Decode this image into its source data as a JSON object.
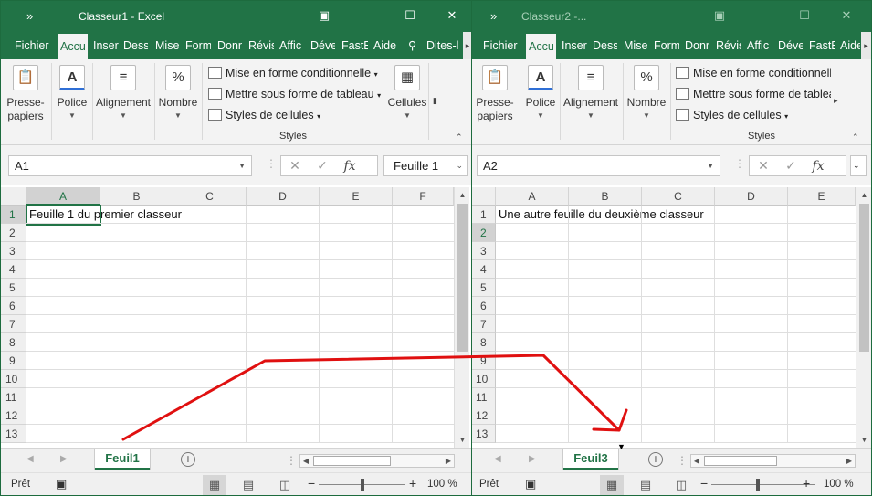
{
  "window1": {
    "title": "Classeur1  -  Excel",
    "tabs": [
      "Fichier",
      "Accu",
      "Inser",
      "Dess",
      "Mise",
      "Form",
      "Donr",
      "Révis",
      "Affic",
      "Déve",
      "FastE",
      "Aide"
    ],
    "tell_me": "Dites-l",
    "ribbon": {
      "paste": "Presse-\npapiers",
      "font": "Police",
      "alignment": "Alignement",
      "number": "Nombre",
      "cond_format": "Mise en forme conditionnelle",
      "table_format": "Mettre sous forme de tableau",
      "cell_styles": "Styles de cellules",
      "styles_group": "Styles",
      "cells": "Cellules"
    },
    "name_box": "A1",
    "formula": "Feuille 1",
    "columns": [
      "A",
      "B",
      "C",
      "D",
      "E",
      "F"
    ],
    "rows": [
      "1",
      "2",
      "3",
      "4",
      "5",
      "6",
      "7",
      "8",
      "9",
      "10",
      "11",
      "12",
      "13"
    ],
    "cell_a1": "Feuille 1 du premier classeur",
    "sheet_tab": "Feuil1",
    "status": "Prêt",
    "zoom": "100 %"
  },
  "window2": {
    "title": "Classeur2  -...",
    "tabs": [
      "Fichier",
      "Accu",
      "Inser",
      "Dess",
      "Mise",
      "Form",
      "Donr",
      "Révis",
      "Affic",
      "Déve",
      "FastE",
      "Aide"
    ],
    "ribbon": {
      "paste": "Presse-\npapiers",
      "font": "Police",
      "alignment": "Alignement",
      "number": "Nombre",
      "cond_format": "Mise en forme conditionnelle",
      "table_format": "Mettre sous forme de tableau",
      "cell_styles": "Styles de cellules",
      "styles_group": "Styles"
    },
    "name_box": "A2",
    "columns": [
      "A",
      "B",
      "C",
      "D",
      "E"
    ],
    "rows": [
      "1",
      "2",
      "3",
      "4",
      "5",
      "6",
      "7",
      "8",
      "9",
      "10",
      "11",
      "12",
      "13"
    ],
    "cell_a1": "Une autre feuille du deuxième classeur",
    "sheet_tab": "Feuil3",
    "status": "Prêt",
    "zoom": "100 %"
  },
  "annotation_color": "#e01010"
}
